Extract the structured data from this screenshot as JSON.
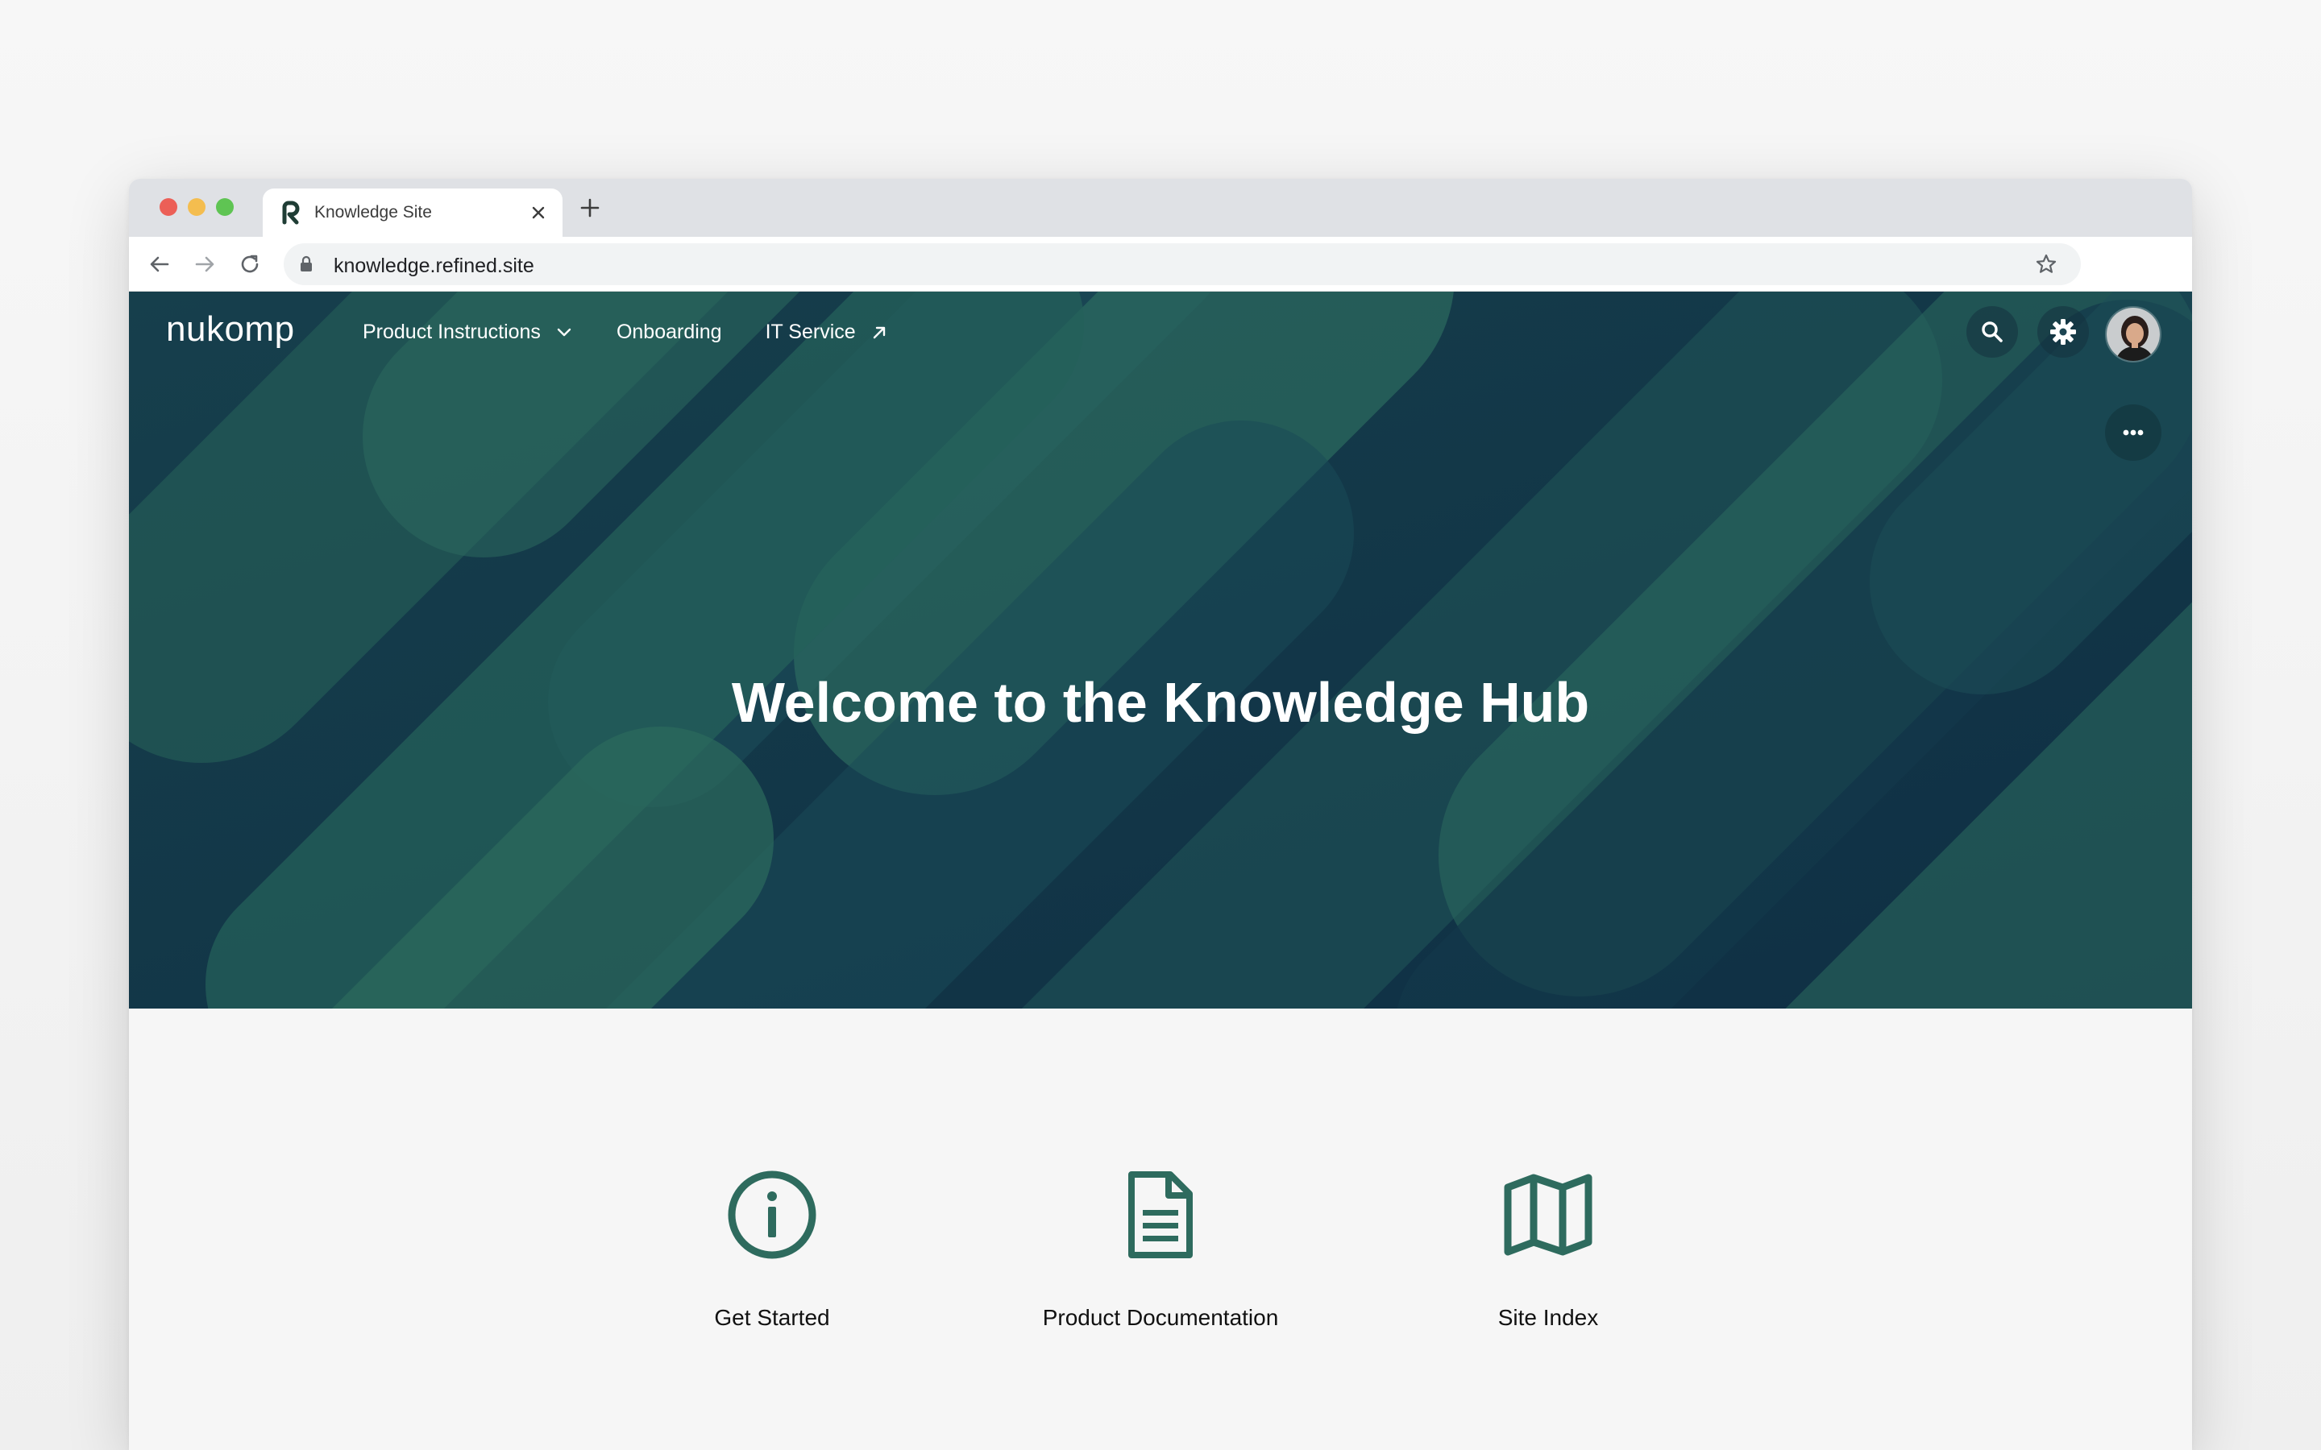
{
  "browser": {
    "tab_title": "Knowledge Site",
    "url": "knowledge.refined.site"
  },
  "header": {
    "brand": "nukomp",
    "nav": [
      {
        "label": "Product Instructions",
        "icon": "chevron-down-icon"
      },
      {
        "label": "Onboarding"
      },
      {
        "label": "IT Service",
        "icon": "external-link-icon"
      }
    ]
  },
  "hero": {
    "title": "Welcome to the Knowledge Hub"
  },
  "cards": [
    {
      "label": "Get Started",
      "icon": "info-icon"
    },
    {
      "label": "Product Documentation",
      "icon": "document-icon"
    },
    {
      "label": "Site Index",
      "icon": "map-icon"
    }
  ],
  "colors": {
    "accent": "#2e6b5e",
    "hero_base": "#143a4a"
  }
}
